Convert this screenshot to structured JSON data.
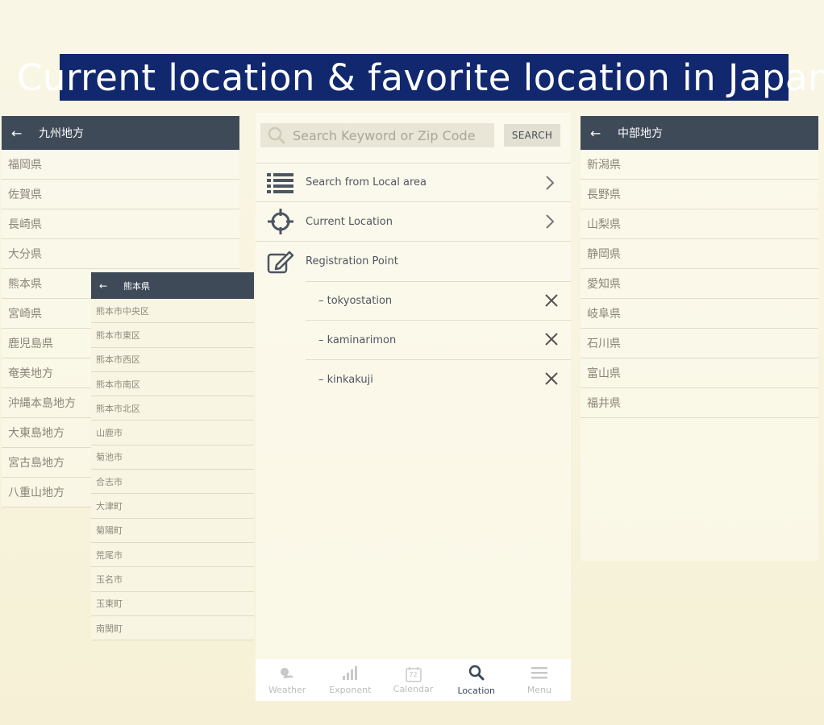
{
  "banner": {
    "title": "Current location & favorite location in Japan"
  },
  "left_panel": {
    "title": "九州地方",
    "items": [
      "福岡県",
      "佐賀県",
      "長崎県",
      "大分県",
      "熊本県",
      "宮崎県",
      "鹿児島県",
      "奄美地方",
      "沖縄本島地方",
      "大東島地方",
      "宮古島地方",
      "八重山地方"
    ]
  },
  "sub_panel": {
    "title": "熊本県",
    "items": [
      "熊本市中央区",
      "熊本市東区",
      "熊本市西区",
      "熊本市南区",
      "熊本市北区",
      "山鹿市",
      "菊池市",
      "合志市",
      "大津町",
      "菊陽町",
      "荒尾市",
      "玉名市",
      "玉東町",
      "南関町"
    ]
  },
  "right_panel": {
    "title": "中部地方",
    "items": [
      "新潟県",
      "長野県",
      "山梨県",
      "静岡県",
      "愛知県",
      "岐阜県",
      "石川県",
      "富山県",
      "福井県"
    ]
  },
  "center": {
    "search": {
      "placeholder": "Search Keyword or Zip Code",
      "button": "SEARCH"
    },
    "menu": {
      "local_area": "Search from Local area",
      "current_location": "Current Location",
      "registration": "Registration Point"
    },
    "registered": [
      "– tokyostation",
      "– kaminarimon",
      "– kinkakuji"
    ],
    "calendar_day": "72",
    "tabs": [
      "Weather",
      "Exponent",
      "Calendar",
      "Location",
      "Menu"
    ],
    "active_tab": "Location"
  },
  "colors": {
    "banner": "#12286e",
    "appbar": "#3f4a58",
    "background": "#f8f5e1"
  },
  "icons": [
    "back-arrow-icon",
    "search-icon",
    "list-icon",
    "crosshair-icon",
    "edit-icon",
    "chevron-right-icon",
    "close-icon",
    "weather-icon",
    "bar-chart-icon",
    "calendar-icon",
    "hamburger-icon"
  ]
}
